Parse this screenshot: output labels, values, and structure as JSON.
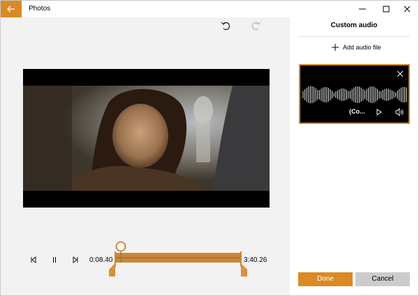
{
  "window": {
    "app_title": "Photos",
    "controls": [
      "minimize",
      "maximize",
      "close"
    ]
  },
  "icons": {
    "back": "back-arrow-icon",
    "undo": "undo-icon",
    "redo": "redo-icon",
    "previous_frame": "previous-frame-icon",
    "pause": "pause-icon",
    "next_frame": "next-frame-icon",
    "close_card": "close-icon",
    "play": "play-icon",
    "volume": "volume-icon",
    "add": "plus-icon"
  },
  "editor": {
    "start_time": "0:08.40",
    "end_time": "3:40.26",
    "redo_enabled": false
  },
  "panel": {
    "title": "Custom audio",
    "add_audio_label": "Add audio file",
    "audio_card": {
      "label": "(Co...",
      "selected": true
    },
    "done_label": "Done",
    "cancel_label": "Cancel"
  },
  "colors": {
    "accent": "#da8a23",
    "panel_bg": "#ffffff",
    "editor_bg": "#f2f2f2",
    "cancel_bg": "#cccccc"
  }
}
